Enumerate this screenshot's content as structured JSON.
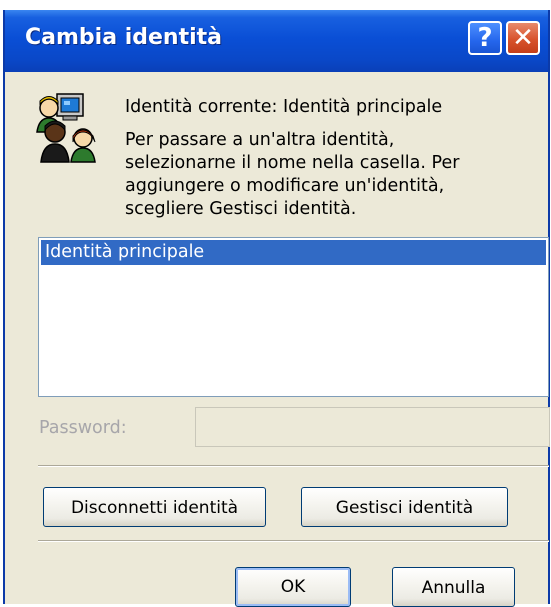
{
  "window": {
    "title": "Cambia identità",
    "help_glyph": "?",
    "close_glyph": "✕"
  },
  "header": {
    "icon": "identity-users-icon",
    "current_identity": "Identità corrente: Identità principale",
    "instructions": [
      "Per passare a un'altra identità,",
      "selezionarne il nome nella casella. Per",
      "aggiungere o modificare un'identità,",
      "scegliere Gestisci identità."
    ]
  },
  "identity_list": {
    "items": [
      {
        "label": "Identità principale",
        "selected": true
      }
    ]
  },
  "password": {
    "label": "Password:",
    "value": ""
  },
  "buttons": {
    "disconnect": "Disconnetti identità",
    "manage": "Gestisci identità",
    "ok": "OK",
    "cancel": "Annulla"
  },
  "colors": {
    "titlebar": "#0a4fd6",
    "dialog_bg": "#ece9d8",
    "selection": "#316ac5",
    "close_button": "#d8532c",
    "disabled_text": "#a7a6aa"
  }
}
